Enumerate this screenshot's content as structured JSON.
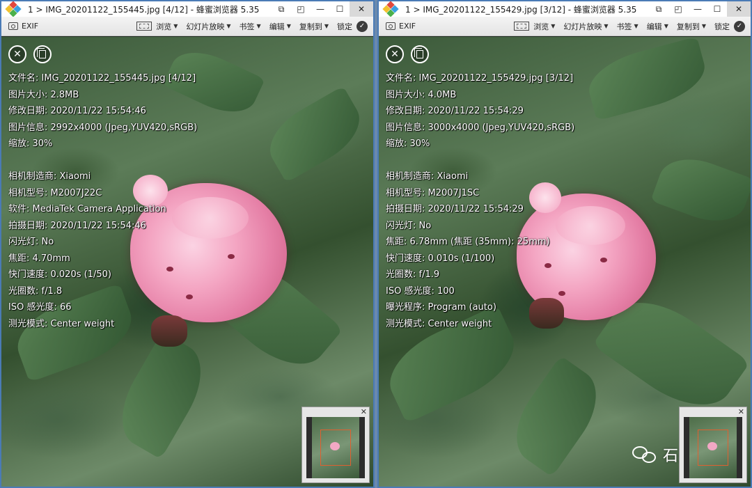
{
  "left_window": {
    "title": "1 > IMG_20201122_155445.jpg [4/12] - 蜂蜜浏览器 5.35",
    "toolbar": {
      "exif": "EXIF",
      "browse": "浏览",
      "slideshow": "幻灯片放映",
      "bookmark": "书签",
      "edit": "编辑",
      "copy_to": "复制到",
      "lock": "锁定"
    },
    "exif_lines": [
      "文件名: IMG_20201122_155445.jpg [4/12]",
      "图片大小: 2.8MB",
      "修改日期: 2020/11/22 15:54:46",
      "图片信息: 2992x4000 (Jpeg,YUV420,sRGB)",
      "缩放: 30%",
      "",
      "相机制造商: Xiaomi",
      "相机型号: M2007J22C",
      "软件: MediaTek Camera Application",
      "拍摄日期: 2020/11/22 15:54:46",
      "闪光灯: No",
      "焦距: 4.70mm",
      "快门速度: 0.020s (1/50)",
      "光圈数: f/1.8",
      "ISO 感光度: 66",
      "测光模式: Center weight"
    ]
  },
  "right_window": {
    "title": "1 > IMG_20201122_155429.jpg [3/12] - 蜂蜜浏览器 5.35",
    "toolbar": {
      "exif": "EXIF",
      "browse": "浏览",
      "slideshow": "幻灯片放映",
      "bookmark": "书签",
      "edit": "编辑",
      "copy_to": "复制到",
      "lock": "锁定"
    },
    "exif_lines": [
      "文件名: IMG_20201122_155429.jpg [3/12]",
      "图片大小: 4.0MB",
      "修改日期: 2020/11/22 15:54:29",
      "图片信息: 3000x4000 (Jpeg,YUV420,sRGB)",
      "缩放: 30%",
      "",
      "相机制造商: Xiaomi",
      "相机型号: M2007J1SC",
      "拍摄日期: 2020/11/22 15:54:29",
      "闪光灯: No",
      "焦距: 6.78mm (焦距 (35mm): 25mm)",
      "快门速度: 0.010s (1/100)",
      "光圈数: f/1.9",
      "ISO 感光度: 100",
      "曝光程序: Program (auto)",
      "测光模式: Center weight"
    ]
  },
  "watermark": {
    "text": "石头搞机"
  },
  "icons": {
    "window_controls": [
      "restore-icon",
      "pin-icon",
      "minimize-icon",
      "maximize-icon",
      "close-icon"
    ],
    "overlay": [
      "close-circle-icon",
      "copy-icon"
    ]
  },
  "colors": {
    "border": "#4a7bb6",
    "rose": "#f4a6c3",
    "text_overlay": "#ffffff"
  }
}
